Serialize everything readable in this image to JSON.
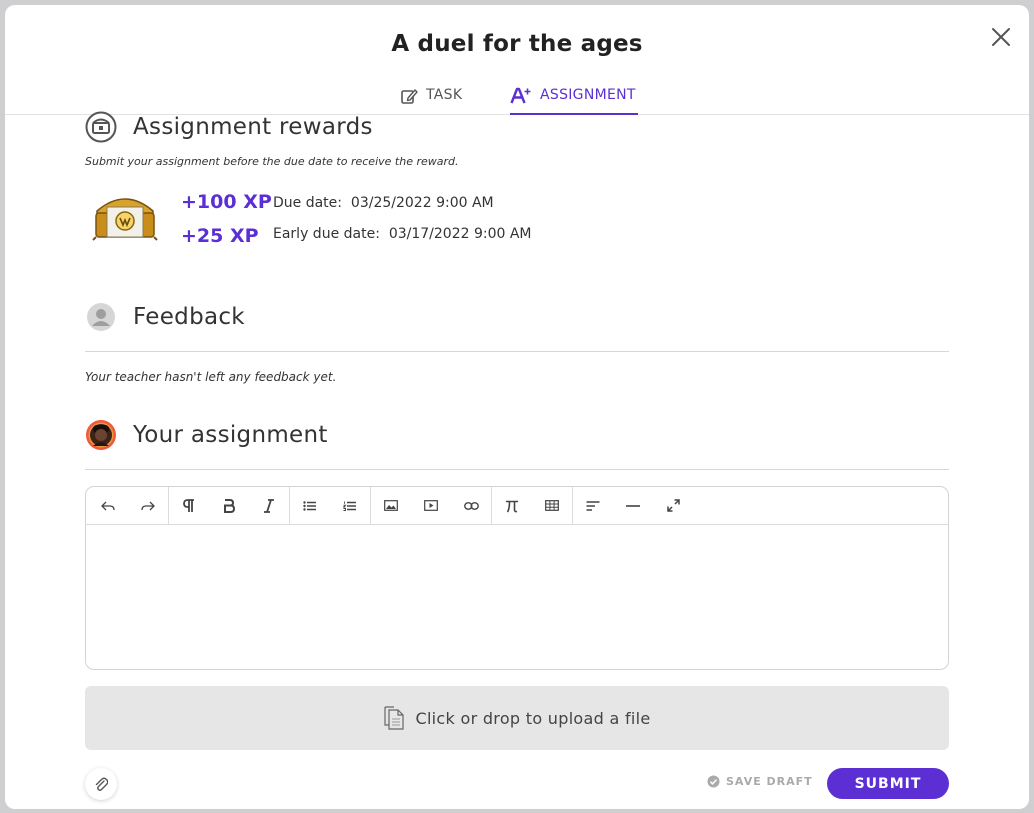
{
  "modal": {
    "title": "A duel for the ages"
  },
  "tabs": [
    {
      "label": "TASK",
      "icon": "edit-icon",
      "active": false
    },
    {
      "label": "ASSIGNMENT",
      "icon": "a-plus-icon",
      "active": true
    }
  ],
  "rewards": {
    "heading": "Assignment rewards",
    "note": "Submit your assignment before the due date to receive the reward.",
    "xp_main": "+100 XP",
    "xp_early": "+25 XP",
    "due_label": "Due date:",
    "due_value": "03/25/2022 9:00 AM",
    "early_label": "Early due date:",
    "early_value": "03/17/2022 9:00 AM"
  },
  "feedback": {
    "heading": "Feedback",
    "note": "Your teacher hasn't left any feedback yet."
  },
  "assignment": {
    "heading": "Your assignment",
    "upload_label": "Click or drop to upload a file",
    "save_draft_label": "SAVE DRAFT",
    "submit_label": "SUBMIT"
  },
  "toolbar": {
    "groups": [
      [
        "undo-icon",
        "redo-icon"
      ],
      [
        "paragraph-icon",
        "bold-icon",
        "italic-icon"
      ],
      [
        "bullet-list-icon",
        "numbered-list-icon"
      ],
      [
        "image-icon",
        "video-icon",
        "link-icon"
      ],
      [
        "pi-icon",
        "table-icon"
      ],
      [
        "align-left-icon",
        "horizontal-rule-icon",
        "fullscreen-icon"
      ]
    ]
  },
  "colors": {
    "accent": "#5c2fd4",
    "text": "#333333",
    "muted": "#aaaaaa",
    "upload_bg": "#e6e6e6"
  }
}
